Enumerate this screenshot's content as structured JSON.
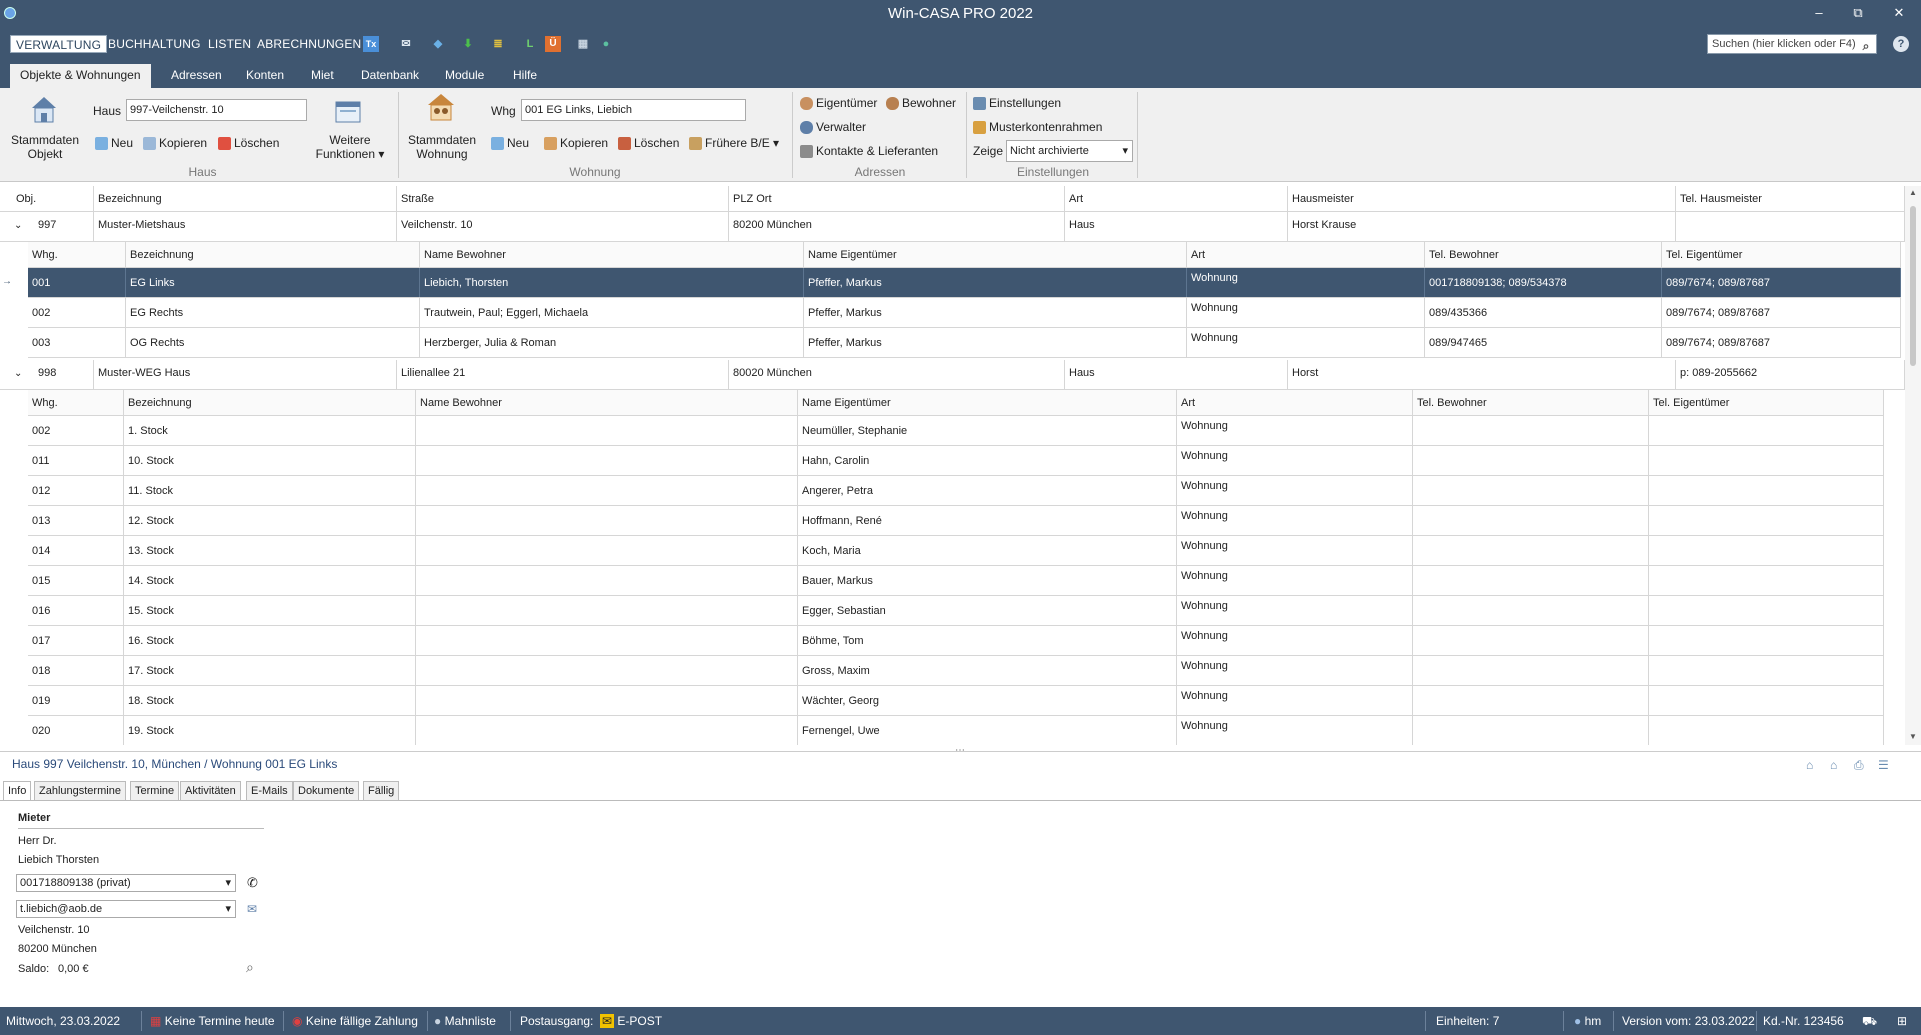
{
  "window": {
    "title": "Win-CASA PRO 2022",
    "minimize": "–",
    "maximize": "⧉",
    "close": "✕"
  },
  "menubar": {
    "items": [
      "VERWALTUNG",
      "BUCHHALTUNG",
      "LISTEN",
      "ABRECHNUNGEN"
    ],
    "search_placeholder": "Suchen (hier klicken oder F4)"
  },
  "ribbon_tabs": [
    "Objekte & Wohnungen",
    "Adressen",
    "Konten",
    "Miet",
    "Datenbank",
    "Module",
    "Hilfe"
  ],
  "ribbon": {
    "haus": {
      "stammdaten": [
        "Stammdaten",
        "Objekt"
      ],
      "label": "Haus",
      "value": "997-Veilchenstr. 10",
      "neu": "Neu",
      "kopieren": "Kopieren",
      "loeschen": "Löschen",
      "weitere": [
        "Weitere",
        "Funktionen ▾"
      ],
      "group": "Haus"
    },
    "wohnung": {
      "stammdaten": [
        "Stammdaten",
        "Wohnung"
      ],
      "label": "Whg",
      "value": "001  EG Links,  Liebich",
      "neu": "Neu",
      "kopieren": "Kopieren",
      "loeschen": "Löschen",
      "fruehere": "Frühere B/E",
      "group": "Wohnung"
    },
    "adressen": {
      "eigentuemer": "Eigentümer",
      "bewohner": "Bewohner",
      "verwalter": "Verwalter",
      "kontakte": "Kontakte & Lieferanten",
      "group": "Adressen"
    },
    "einstellungen": {
      "einstellungen": "Einstellungen",
      "muster": "Musterkontenrahmen",
      "zeige_label": "Zeige",
      "zeige_value": "Nicht archivierte",
      "group": "Einstellungen"
    }
  },
  "grid": {
    "columns": [
      "Obj.",
      "Bezeichnung",
      "Straße",
      "PLZ Ort",
      "Art",
      "Hausmeister",
      "Tel. Hausmeister"
    ],
    "sub_columns": [
      "Whg.",
      "Bezeichnung",
      "Name Bewohner",
      "Name Eigentümer",
      "Art",
      "Tel. Bewohner",
      "Tel. Eigentümer"
    ],
    "houses": [
      {
        "obj": "997",
        "bezeichnung": "Muster-Mietshaus",
        "strasse": "Veilchenstr. 10",
        "plz_ort": "80200 München",
        "art": "Haus",
        "hausmeister": "Horst Krause",
        "tel": "",
        "units": [
          {
            "whg": "001",
            "bez": "EG Links",
            "bewohner": "Liebich, Thorsten",
            "eigentuemer": "Pfeffer, Markus",
            "art": "Wohnung",
            "tel_bew": "001718809138; 089/534378",
            "tel_eig": "089/7674; 089/87687",
            "selected": true
          },
          {
            "whg": "002",
            "bez": "EG Rechts",
            "bewohner": "Trautwein, Paul; Eggerl, Michaela",
            "eigentuemer": "Pfeffer, Markus",
            "art": "Wohnung",
            "tel_bew": "089/435366",
            "tel_eig": "089/7674; 089/87687"
          },
          {
            "whg": "003",
            "bez": "OG Rechts",
            "bewohner": "Herzberger, Julia & Roman",
            "eigentuemer": "Pfeffer, Markus",
            "art": "Wohnung",
            "tel_bew": "089/947465",
            "tel_eig": "089/7674; 089/87687"
          }
        ]
      },
      {
        "obj": "998",
        "bezeichnung": "Muster-WEG Haus",
        "strasse": "Lilienallee 21",
        "plz_ort": "80020 München",
        "art": "Haus",
        "hausmeister": "Horst",
        "tel": "p: 089-2055662",
        "units": [
          {
            "whg": "002",
            "bez": "1. Stock",
            "bewohner": "",
            "eigentuemer": "Neumüller, Stephanie",
            "art": "Wohnung",
            "tel_bew": "",
            "tel_eig": ""
          },
          {
            "whg": "011",
            "bez": "10. Stock",
            "bewohner": "",
            "eigentuemer": "Hahn, Carolin",
            "art": "Wohnung",
            "tel_bew": "",
            "tel_eig": ""
          },
          {
            "whg": "012",
            "bez": "11. Stock",
            "bewohner": "",
            "eigentuemer": "Angerer, Petra",
            "art": "Wohnung",
            "tel_bew": "",
            "tel_eig": ""
          },
          {
            "whg": "013",
            "bez": "12. Stock",
            "bewohner": "",
            "eigentuemer": "Hoffmann, René",
            "art": "Wohnung",
            "tel_bew": "",
            "tel_eig": ""
          },
          {
            "whg": "014",
            "bez": "13. Stock",
            "bewohner": "",
            "eigentuemer": "Koch, Maria",
            "art": "Wohnung",
            "tel_bew": "",
            "tel_eig": ""
          },
          {
            "whg": "015",
            "bez": "14. Stock",
            "bewohner": "",
            "eigentuemer": "Bauer, Markus",
            "art": "Wohnung",
            "tel_bew": "",
            "tel_eig": ""
          },
          {
            "whg": "016",
            "bez": "15. Stock",
            "bewohner": "",
            "eigentuemer": "Egger, Sebastian",
            "art": "Wohnung",
            "tel_bew": "",
            "tel_eig": ""
          },
          {
            "whg": "017",
            "bez": "16. Stock",
            "bewohner": "",
            "eigentuemer": "Böhme, Tom",
            "art": "Wohnung",
            "tel_bew": "",
            "tel_eig": ""
          },
          {
            "whg": "018",
            "bez": "17. Stock",
            "bewohner": "",
            "eigentuemer": "Gross, Maxim",
            "art": "Wohnung",
            "tel_bew": "",
            "tel_eig": ""
          },
          {
            "whg": "019",
            "bez": "18. Stock",
            "bewohner": "",
            "eigentuemer": "Wächter, Georg",
            "art": "Wohnung",
            "tel_bew": "",
            "tel_eig": ""
          },
          {
            "whg": "020",
            "bez": "19. Stock",
            "bewohner": "",
            "eigentuemer": "Fernengel, Uwe",
            "art": "Wohnung",
            "tel_bew": "",
            "tel_eig": ""
          }
        ]
      }
    ]
  },
  "detail": {
    "breadcrumb": "Haus 997 Veilchenstr. 10, München / Wohnung 001 EG Links",
    "tabs": [
      "Info",
      "Zahlungstermine",
      "Termine",
      "Aktivitäten",
      "E-Mails",
      "Dokumente",
      "Fällig"
    ],
    "section": "Mieter",
    "anrede": "Herr Dr.",
    "name": "Liebich Thorsten",
    "phone": "001718809138 (privat)",
    "email": "t.liebich@aob.de",
    "street": "Veilchenstr. 10",
    "city": "80200 München",
    "saldo_label": "Saldo:",
    "saldo_value": "0,00 €"
  },
  "statusbar": {
    "date": "Mittwoch, 23.03.2022",
    "termine": "Keine Termine heute",
    "zahlung": "Keine fällige Zahlung",
    "mahnliste": "Mahnliste",
    "postausgang": "Postausgang:",
    "epost": "E-POST",
    "einheiten": "Einheiten: 7",
    "user": "hm",
    "version": "Version vom: 23.03.2022",
    "kdnr": "Kd.-Nr. 123456"
  },
  "colors": {
    "dark": "#3f5670",
    "ribbon": "#f0f0f0",
    "selection": "#3f5670"
  }
}
